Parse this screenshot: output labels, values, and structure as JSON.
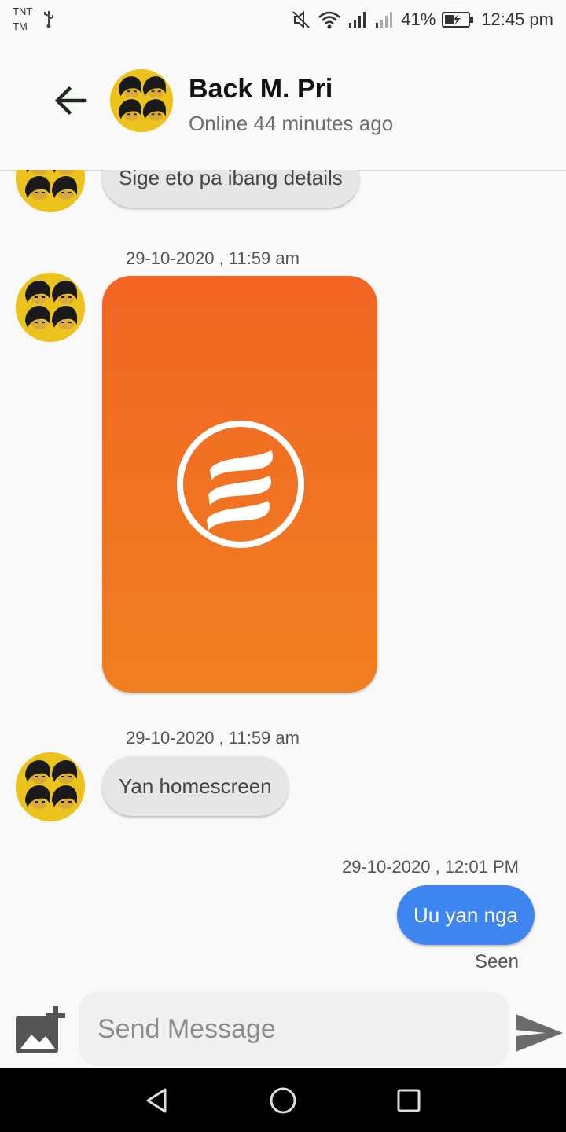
{
  "status_bar": {
    "carrier_line1": "TNT",
    "carrier_line2": "TM",
    "battery": "41%",
    "time": "12:45 pm"
  },
  "header": {
    "contact_name": "Back M. Pri",
    "contact_status": "Online 44 minutes ago"
  },
  "messages": [
    {
      "direction": "in",
      "text": "Sige eto pa ibang details"
    },
    {
      "direction": "in",
      "timestamp": "29-10-2020 , 11:59 am",
      "type": "image"
    },
    {
      "direction": "in",
      "timestamp": "29-10-2020 , 11:59 am",
      "text": "Yan homescreen"
    },
    {
      "direction": "out",
      "timestamp": "29-10-2020 , 12:01 PM",
      "text": "Uu yan nga",
      "receipt": "Seen"
    }
  ],
  "composer": {
    "placeholder": "Send Message"
  },
  "colors": {
    "outgoing_bubble": "#3e85ef",
    "incoming_bubble": "#e6e6e6",
    "avatar_bg": "#ecc31c",
    "image_top": "#f26522",
    "image_bottom": "#f07f21"
  }
}
